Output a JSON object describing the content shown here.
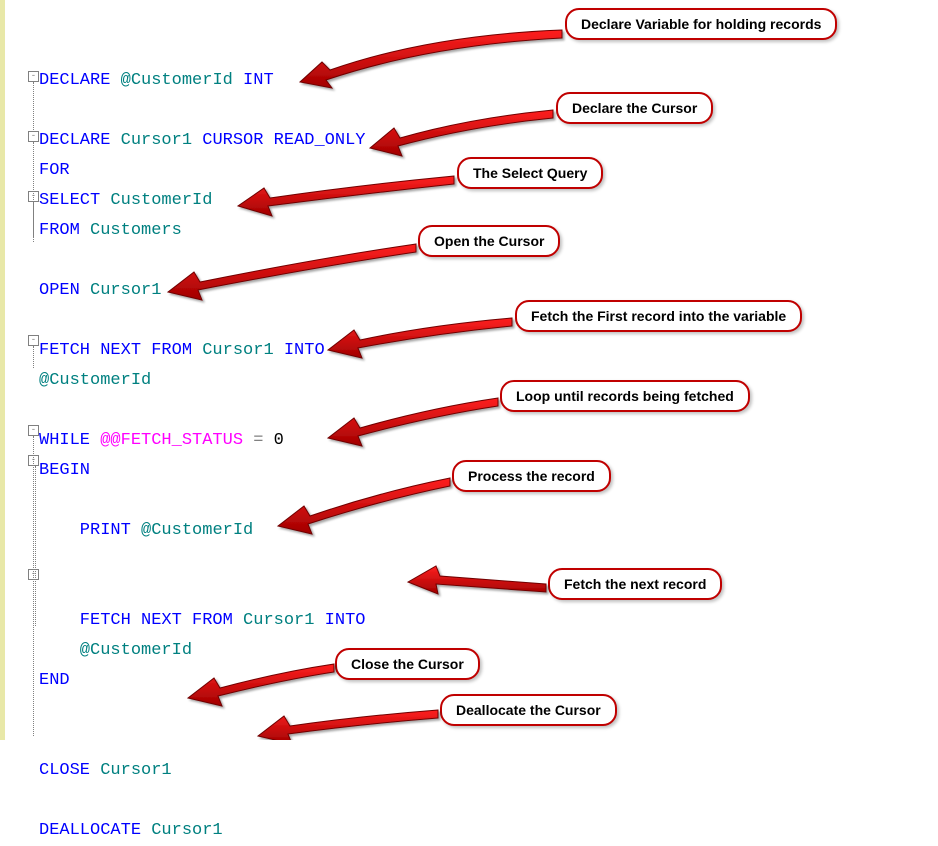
{
  "code": {
    "l1": {
      "a": "DECLARE ",
      "b": "@CustomerId ",
      "c": "INT"
    },
    "l2": {
      "a": "DECLARE ",
      "b": "Cursor1 ",
      "c": "CURSOR READ_ONLY"
    },
    "l3": {
      "a": "FOR"
    },
    "l4": {
      "a": "SELECT ",
      "b": "CustomerId"
    },
    "l5": {
      "a": "FROM ",
      "b": "Customers"
    },
    "l6": {
      "a": "OPEN ",
      "b": "Cursor1"
    },
    "l7": {
      "a": "FETCH NEXT FROM ",
      "b": "Cursor1 ",
      "c": "INTO"
    },
    "l8": {
      "a": "@CustomerId"
    },
    "l9": {
      "a": "WHILE ",
      "b": "@@FETCH_STATUS ",
      "c": "= ",
      "d": "0"
    },
    "l10": {
      "a": "BEGIN"
    },
    "l11": {
      "a": "    PRINT ",
      "b": "@CustomerId"
    },
    "l12": {
      "a": "    FETCH NEXT FROM ",
      "b": "Cursor1 ",
      "c": "INTO"
    },
    "l13": {
      "a": "    @CustomerId"
    },
    "l14": {
      "a": "END"
    },
    "l15": {
      "a": "CLOSE ",
      "b": "Cursor1"
    },
    "l16": {
      "a": "DEALLOCATE ",
      "b": "Cursor1"
    }
  },
  "callouts": {
    "c1": "Declare Variable for holding records",
    "c2": "Declare the Cursor",
    "c3": "The Select Query",
    "c4": "Open the Cursor",
    "c5": "Fetch the First record into the variable",
    "c6": "Loop until records being fetched",
    "c7": "Process the record",
    "c8": "Fetch the next record",
    "c9": "Close the Cursor",
    "c10": "Deallocate the Cursor"
  },
  "fold_glyph": "-"
}
